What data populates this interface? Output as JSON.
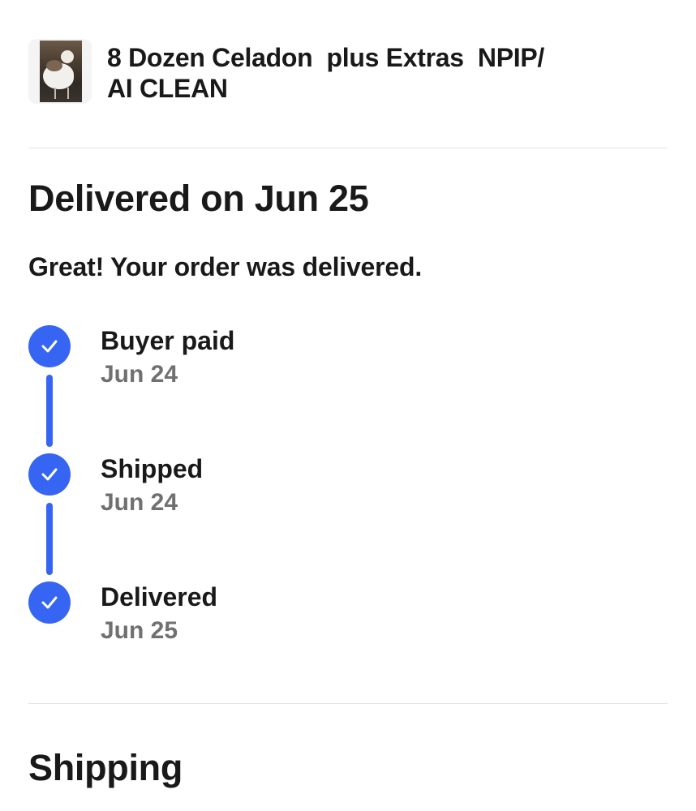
{
  "item": {
    "title": "8 Dozen Celadon  plus Extras  NPIP/\nAI CLEAN",
    "thumbnail_alt": "bird photo"
  },
  "status": {
    "heading": "Delivered on Jun 25",
    "message": "Great! Your order was delivered."
  },
  "timeline": {
    "steps": [
      {
        "label": "Buyer paid",
        "date": "Jun 24",
        "icon": "checkmark-icon",
        "complete": true
      },
      {
        "label": "Shipped",
        "date": "Jun 24",
        "icon": "checkmark-icon",
        "complete": true
      },
      {
        "label": "Delivered",
        "date": "Jun 25",
        "icon": "checkmark-icon",
        "complete": true
      }
    ]
  },
  "shipping": {
    "heading": "Shipping"
  },
  "colors": {
    "accent": "#3665f3",
    "text_primary": "#191919",
    "text_secondary": "#707070",
    "divider": "#e2e2e2"
  }
}
